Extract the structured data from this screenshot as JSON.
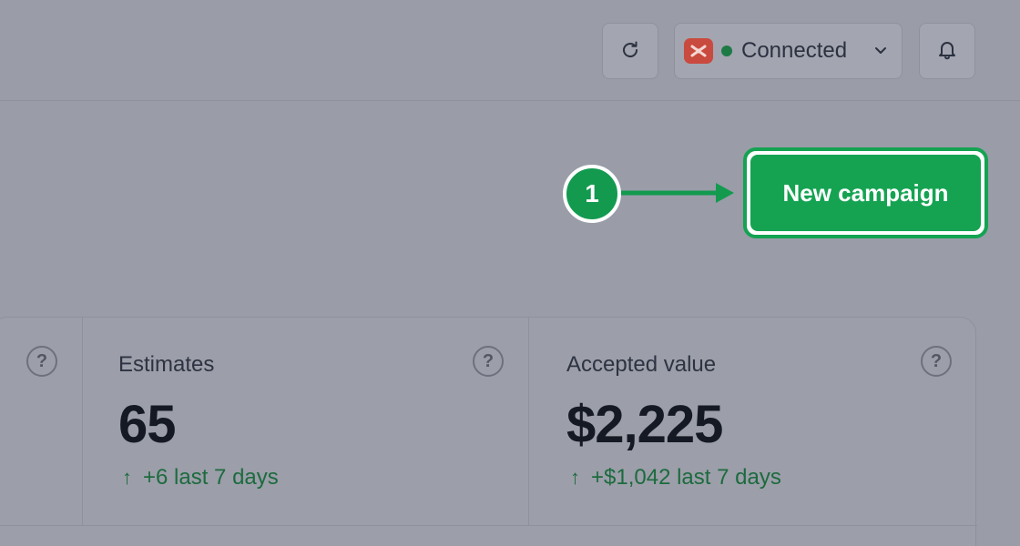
{
  "header": {
    "refresh_icon": "refresh-icon",
    "connection": {
      "app_icon": "integration-logo-icon",
      "status_color": "#1d7a45",
      "label": "Connected",
      "dropdown_icon": "chevron-down-icon"
    },
    "bell_icon": "bell-icon"
  },
  "callout": {
    "number": "1",
    "color": "#139a4f"
  },
  "actions": {
    "new_campaign_label": "New campaign",
    "accent": "#15a352"
  },
  "stats": [
    {
      "title": "Estimates",
      "value": "65",
      "delta": "+6 last 7 days",
      "delta_icon": "arrow-up-icon",
      "help_label": "?"
    },
    {
      "title": "Accepted value",
      "value": "$2,225",
      "delta": "+$1,042 last 7 days",
      "delta_icon": "arrow-up-icon",
      "help_label": "?"
    }
  ],
  "partial_card": {
    "help_label": "?"
  }
}
